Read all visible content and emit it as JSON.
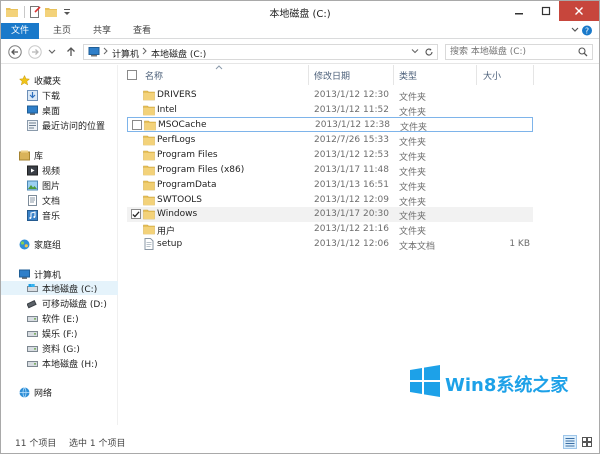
{
  "window": {
    "title": "本地磁盘 (C:)"
  },
  "ribbon": {
    "tabs": [
      {
        "label": "文件"
      },
      {
        "label": "主页"
      },
      {
        "label": "共享"
      },
      {
        "label": "查看"
      }
    ]
  },
  "address": {
    "crumbs": [
      "计算机",
      "本地磁盘 (C:)"
    ]
  },
  "search": {
    "placeholder": "搜索 本地磁盘 (C:)"
  },
  "navpane": {
    "favorites": {
      "label": "收藏夹",
      "items": [
        "下载",
        "桌面",
        "最近访问的位置"
      ]
    },
    "libraries": {
      "label": "库",
      "items": [
        "视频",
        "图片",
        "文档",
        "音乐"
      ]
    },
    "homegroup": {
      "label": "家庭组"
    },
    "computer": {
      "label": "计算机",
      "items": [
        "本地磁盘 (C:)",
        "可移动磁盘 (D:)",
        "软件 (E:)",
        "娱乐 (F:)",
        "资料 (G:)",
        "本地磁盘 (H:)"
      ]
    },
    "network": {
      "label": "网络"
    }
  },
  "columns": {
    "name": "名称",
    "date": "修改日期",
    "type": "类型",
    "size": "大小"
  },
  "files": [
    {
      "name": "DRIVERS",
      "date": "2013/1/12 12:30",
      "type": "文件夹",
      "size": ""
    },
    {
      "name": "Intel",
      "date": "2013/1/12 11:52",
      "type": "文件夹",
      "size": ""
    },
    {
      "name": "MSOCache",
      "date": "2013/1/12 12:38",
      "type": "文件夹",
      "size": ""
    },
    {
      "name": "PerfLogs",
      "date": "2012/7/26 15:33",
      "type": "文件夹",
      "size": ""
    },
    {
      "name": "Program Files",
      "date": "2013/1/12 12:53",
      "type": "文件夹",
      "size": ""
    },
    {
      "name": "Program Files (x86)",
      "date": "2013/1/17 11:48",
      "type": "文件夹",
      "size": ""
    },
    {
      "name": "ProgramData",
      "date": "2013/1/13 16:51",
      "type": "文件夹",
      "size": ""
    },
    {
      "name": "SWTOOLS",
      "date": "2013/1/12 12:09",
      "type": "文件夹",
      "size": ""
    },
    {
      "name": "Windows",
      "date": "2013/1/17 20:30",
      "type": "文件夹",
      "size": ""
    },
    {
      "name": "用户",
      "date": "2013/1/12 21:16",
      "type": "文件夹",
      "size": ""
    },
    {
      "name": "setup",
      "date": "2013/1/12 12:06",
      "type": "文本文档",
      "size": "1 KB"
    }
  ],
  "status": {
    "count": "11 个项目",
    "selected": "选中 1 个项目"
  },
  "watermark": {
    "text": "Win8系统之家"
  },
  "colors": {
    "file_tab": "#1979ca",
    "folder": "#e8c15a",
    "close": "#c7463c",
    "watermark": "#1da1e8"
  }
}
